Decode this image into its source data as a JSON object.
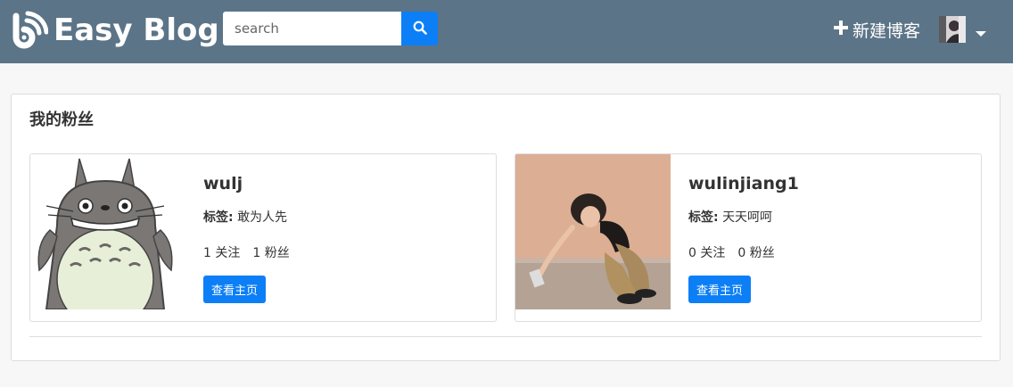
{
  "navbar": {
    "brand": "Easy Blog",
    "search": {
      "placeholder": "search",
      "value": ""
    },
    "new_post_label": "新建博客",
    "icons": [
      "blog-logo-icon",
      "search-icon",
      "plus-icon",
      "caret-down-icon"
    ]
  },
  "section": {
    "title": "我的粉丝"
  },
  "fans": [
    {
      "name": "wulj",
      "tag_label": "标签:",
      "tag_value": "敢为人先",
      "following": "1 关注",
      "followers": "1 粉丝",
      "button": "查看主页"
    },
    {
      "name": "wulinjiang1",
      "tag_label": "标签:",
      "tag_value": "天天呵呵",
      "following": "0 关注",
      "followers": "0 粉丝",
      "button": "查看主页"
    }
  ],
  "colors": {
    "navbar_bg": "#5c7487",
    "accent": "#0d7ff6",
    "page_bg": "#f7f7f7"
  }
}
